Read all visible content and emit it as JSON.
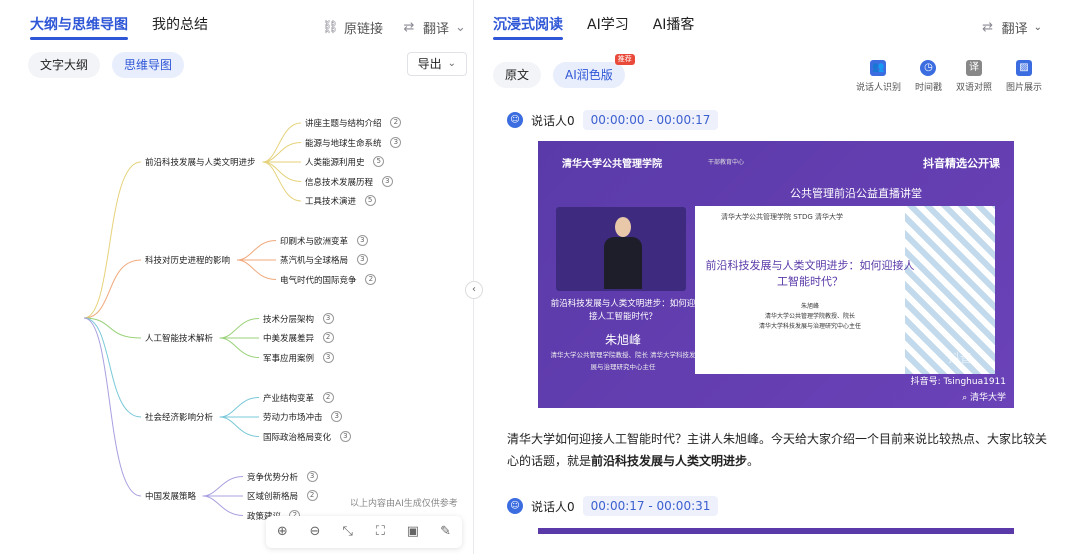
{
  "left": {
    "tabs": [
      {
        "label": "大纲与思维导图",
        "active": true
      },
      {
        "label": "我的总结",
        "active": false
      }
    ],
    "actions": {
      "link": "原链接",
      "translate": "翻译"
    },
    "subtabs": [
      {
        "label": "文字大纲",
        "active": false
      },
      {
        "label": "思维导图",
        "active": true
      }
    ],
    "export": "导出",
    "disclaimer": "以上内容由AI生成仅供参考"
  },
  "mindmap": {
    "branches": [
      {
        "label": "前沿科技发展与人类文明进步",
        "color": "#e6d27a",
        "children": [
          {
            "label": "讲座主题与结构介绍",
            "count": "2"
          },
          {
            "label": "能源与地球生命系统",
            "count": "3"
          },
          {
            "label": "人类能源利用史",
            "count": "5"
          },
          {
            "label": "信息技术发展历程",
            "count": "3"
          },
          {
            "label": "工具技术演进",
            "count": "5"
          }
        ]
      },
      {
        "label": "科技对历史进程的影响",
        "color": "#f0a87a",
        "children": [
          {
            "label": "印刷术与欧洲变革",
            "count": "3"
          },
          {
            "label": "蒸汽机与全球格局",
            "count": "3"
          },
          {
            "label": "电气时代的国际竞争",
            "count": "2"
          }
        ]
      },
      {
        "label": "人工智能技术解析",
        "color": "#9ad27a",
        "children": [
          {
            "label": "技术分层架构",
            "count": "3"
          },
          {
            "label": "中美发展差异",
            "count": "2"
          },
          {
            "label": "军事应用案例",
            "count": "3"
          }
        ]
      },
      {
        "label": "社会经济影响分析",
        "color": "#7ac8d8",
        "children": [
          {
            "label": "产业结构变革",
            "count": "2"
          },
          {
            "label": "劳动力市场冲击",
            "count": "3"
          },
          {
            "label": "国际政治格局变化",
            "count": "3"
          }
        ]
      },
      {
        "label": "中国发展策略",
        "color": "#a8a0e0",
        "children": [
          {
            "label": "竞争优势分析",
            "count": "3"
          },
          {
            "label": "区域创新格局",
            "count": "2"
          },
          {
            "label": "政策建议",
            "count": "2"
          }
        ]
      }
    ]
  },
  "toolbar": {
    "icons": [
      "zoom-in-icon",
      "zoom-out-icon",
      "shrink-icon",
      "fullscreen-icon",
      "panel-icon",
      "edit-icon"
    ]
  },
  "right": {
    "tabs": [
      {
        "label": "沉浸式阅读",
        "active": true
      },
      {
        "label": "AI学习",
        "active": false
      },
      {
        "label": "AI播客",
        "active": false
      }
    ],
    "translate": "翻译",
    "subtabs": [
      {
        "label": "原文",
        "active": false
      },
      {
        "label": "AI润色版",
        "active": true,
        "badge": "推荐"
      }
    ],
    "tools": [
      {
        "label": "说话人识别",
        "icon": "people-icon"
      },
      {
        "label": "时间戳",
        "icon": "clock-icon"
      },
      {
        "label": "双语对照",
        "icon": "bilingual-icon"
      },
      {
        "label": "图片展示",
        "icon": "image-icon"
      }
    ],
    "segments": [
      {
        "speaker": "说话人0",
        "time": "00:00:00 - 00:00:17"
      },
      {
        "speaker": "说话人0",
        "time": "00:00:17 - 00:00:31"
      }
    ],
    "paragraph": {
      "text": "清华大学如何迎接人工智能时代？主讲人朱旭峰。今天给大家介绍一个目前来说比较热点、大家比较关心的话题，就是",
      "bold": "前沿科技发展与人类文明进步",
      "end": "。"
    }
  },
  "video": {
    "logo": "清华大学公共管理学院",
    "center": "干部教育中心",
    "brand": "抖音精选公开课",
    "header_title": "公共管理前沿公益直播讲堂",
    "speaker_title": "前沿科技发展与人类文明进步：如何迎接人工智能时代？",
    "speaker_name": "朱旭峰",
    "speaker_desc": "清华大学公共管理学院教授、院长 清华大学科技发展与治理研究中心主任",
    "slide_logos": "清华大学公共管理学院  STDG  清华大学",
    "slide_title": "前沿科技发展与人类文明进步：如何迎接人工智能时代？",
    "slide_sub_1": "朱旭峰",
    "slide_sub_2": "清华大学公共管理学院教授、院长",
    "slide_sub_3": "清华大学科技发展与治理研究中心主任",
    "watermark": "抖音",
    "douyin_id": "抖音号: Tsinghua1911",
    "search": "清华大学"
  }
}
